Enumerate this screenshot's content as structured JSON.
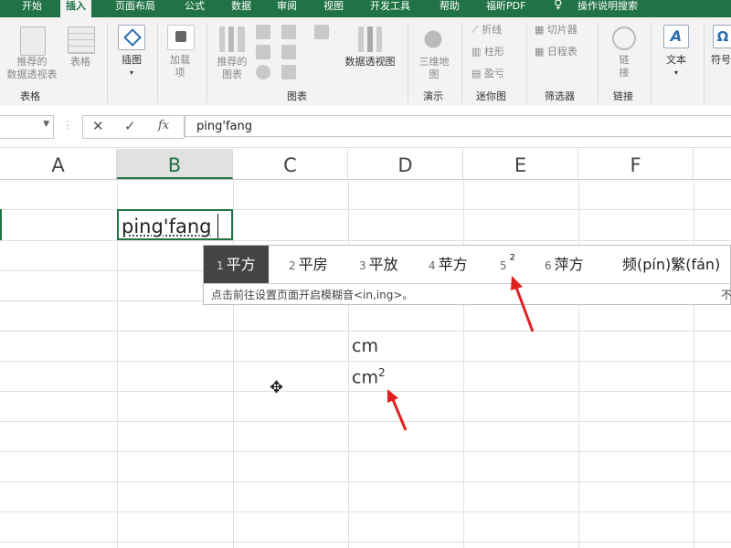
{
  "ribbon_tabs": [
    "开始",
    "插入",
    "页面布局",
    "公式",
    "数据",
    "审阅",
    "视图",
    "开发工具",
    "帮助",
    "福昕PDF",
    "操作说明搜索"
  ],
  "ribbon": {
    "recommended_pivot": "推荐的\n数据透视表",
    "table": "表格",
    "illustrations": "插图",
    "addins": "加载\n项",
    "recommended_charts": "推荐的\n图表",
    "pivot_chart": "数据透视图",
    "map3d": "三维地\n图",
    "spark_line": "折线",
    "spark_column": "柱形",
    "spark_winloss": "盈亏",
    "slicer": "切片器",
    "timeline": "日程表",
    "link": "链\n接",
    "text": "文本",
    "symbol": "符号",
    "groups": {
      "tables": "表格",
      "charts": "图表",
      "tours": "演示",
      "sparklines": "迷你图",
      "filters": "筛选器",
      "links": "链接"
    }
  },
  "formula_bar": {
    "cancel": "✕",
    "enter": "✓",
    "fx": "fx",
    "value": "ping'fang"
  },
  "columns": [
    "A",
    "B",
    "C",
    "D",
    "E",
    "F"
  ],
  "selected_column": "B",
  "active_cell_text": "ping'fang",
  "ime": {
    "candidates": [
      {
        "num": "1",
        "text": "平方"
      },
      {
        "num": "2",
        "text": "平房"
      },
      {
        "num": "3",
        "text": "平放"
      },
      {
        "num": "4",
        "text": "苹方"
      },
      {
        "num": "5",
        "text": "²"
      },
      {
        "num": "6",
        "text": "萍方"
      }
    ],
    "extra_candidate": "频(pín)繁(fán)",
    "hint": "点击前往设置页面开启模糊音<in,ing>。",
    "hint_more": "不"
  },
  "cells": {
    "d_row1": "cm",
    "d_row2_base": "cm",
    "d_row2_sup": "2"
  },
  "colors": {
    "ribbon_green": "#217346",
    "annotation_red": "#e02020"
  }
}
